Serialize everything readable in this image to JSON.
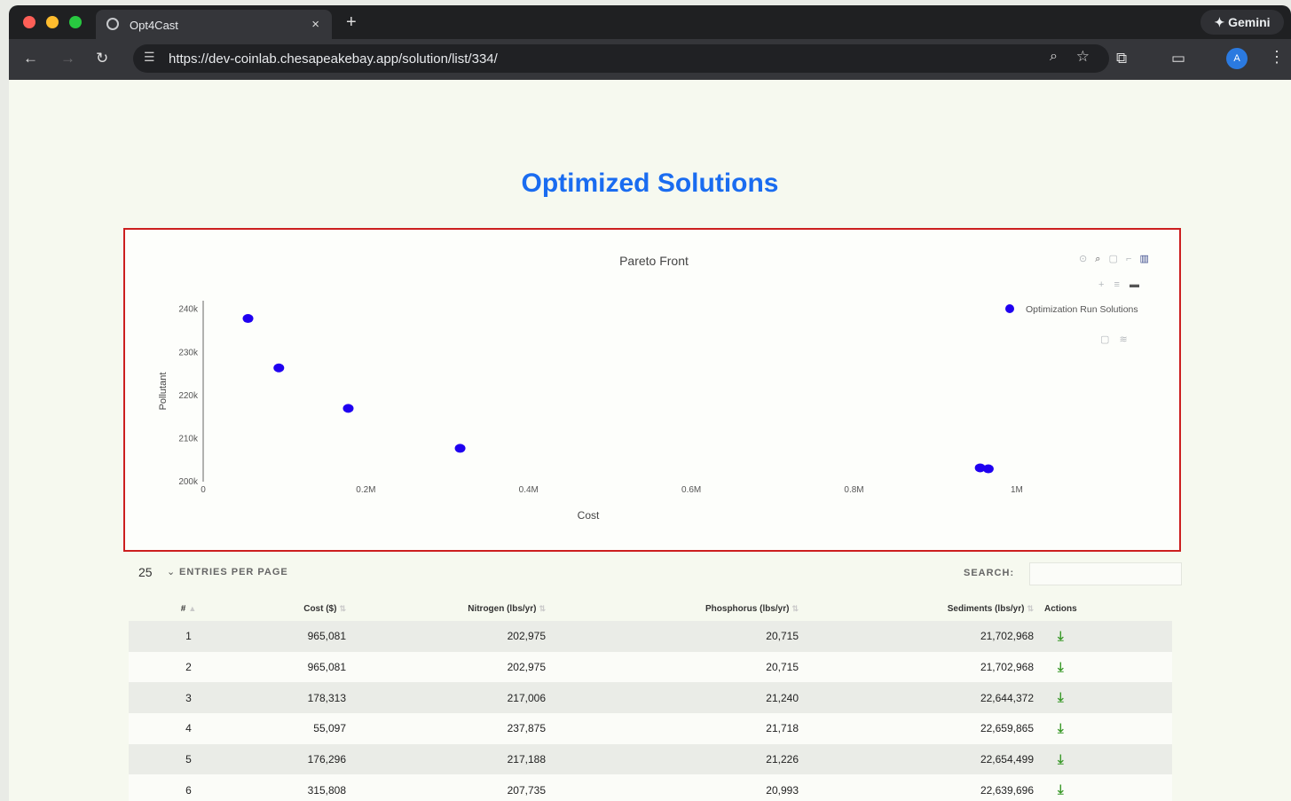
{
  "browser": {
    "tab_title": "Opt4Cast",
    "tab_close": "×",
    "new_tab": "+",
    "gemini_label": "✦ Gemini",
    "url": "https://dev-coinlab.chesapeakebay.app/solution/list/334/",
    "avatar_letter": "A"
  },
  "page": {
    "title": "Optimized Solutions"
  },
  "chart_data": {
    "type": "scatter",
    "title": "Pareto Front",
    "xlabel": "Cost",
    "ylabel": "Pollutant",
    "x_ticks": [
      {
        "value": 0,
        "label": "0"
      },
      {
        "value": 200000,
        "label": "0.2M"
      },
      {
        "value": 400000,
        "label": "0.4M"
      },
      {
        "value": 600000,
        "label": "0.6M"
      },
      {
        "value": 800000,
        "label": "0.8M"
      },
      {
        "value": 1000000,
        "label": "1M"
      }
    ],
    "y_ticks": [
      {
        "value": 200000,
        "label": "200k"
      },
      {
        "value": 210000,
        "label": "210k"
      },
      {
        "value": 220000,
        "label": "220k"
      },
      {
        "value": 230000,
        "label": "230k"
      },
      {
        "value": 240000,
        "label": "240k"
      }
    ],
    "xlim": [
      0,
      1300000
    ],
    "ylim": [
      200000,
      242000
    ],
    "series": [
      {
        "name": "Optimization Run Solutions",
        "color": "#1f00f0",
        "points": [
          {
            "x": 55097,
            "y": 237875
          },
          {
            "x": 93000,
            "y": 226400
          },
          {
            "x": 178313,
            "y": 217006
          },
          {
            "x": 315808,
            "y": 207735
          },
          {
            "x": 955000,
            "y": 203200
          },
          {
            "x": 965081,
            "y": 202975
          }
        ]
      }
    ],
    "legend_position": "top-right",
    "grid": false
  },
  "table": {
    "entries_per_page": "25",
    "entries_label": "ENTRIES PER PAGE",
    "search_label": "SEARCH:",
    "headers": [
      "#",
      "Cost ($)",
      "Nitrogen (lbs/yr)",
      "Phosphorus (lbs/yr)",
      "Sediments (lbs/yr)",
      "Actions"
    ],
    "rows": [
      {
        "num": "1",
        "cost": "965,081",
        "nitrogen": "202,975",
        "phosphorus": "20,715",
        "sediments": "21,702,968"
      },
      {
        "num": "2",
        "cost": "965,081",
        "nitrogen": "202,975",
        "phosphorus": "20,715",
        "sediments": "21,702,968"
      },
      {
        "num": "3",
        "cost": "178,313",
        "nitrogen": "217,006",
        "phosphorus": "21,240",
        "sediments": "22,644,372"
      },
      {
        "num": "4",
        "cost": "55,097",
        "nitrogen": "237,875",
        "phosphorus": "21,718",
        "sediments": "22,659,865"
      },
      {
        "num": "5",
        "cost": "176,296",
        "nitrogen": "217,188",
        "phosphorus": "21,226",
        "sediments": "22,654,499"
      },
      {
        "num": "6",
        "cost": "315,808",
        "nitrogen": "207,735",
        "phosphorus": "20,993",
        "sediments": "22,639,696"
      }
    ]
  },
  "colors": {
    "title_blue": "#1a6cf0",
    "chart_border": "#cc1f1f",
    "marker": "#1f00f0",
    "download_green": "#3c9a2c"
  },
  "icons": [
    "globe-icon",
    "back-arrow-icon",
    "forward-arrow-icon",
    "reload-icon",
    "tune-icon",
    "zoom-icon",
    "star-icon",
    "extensions-icon",
    "tab-search-icon",
    "menu-icon",
    "download-icon"
  ]
}
